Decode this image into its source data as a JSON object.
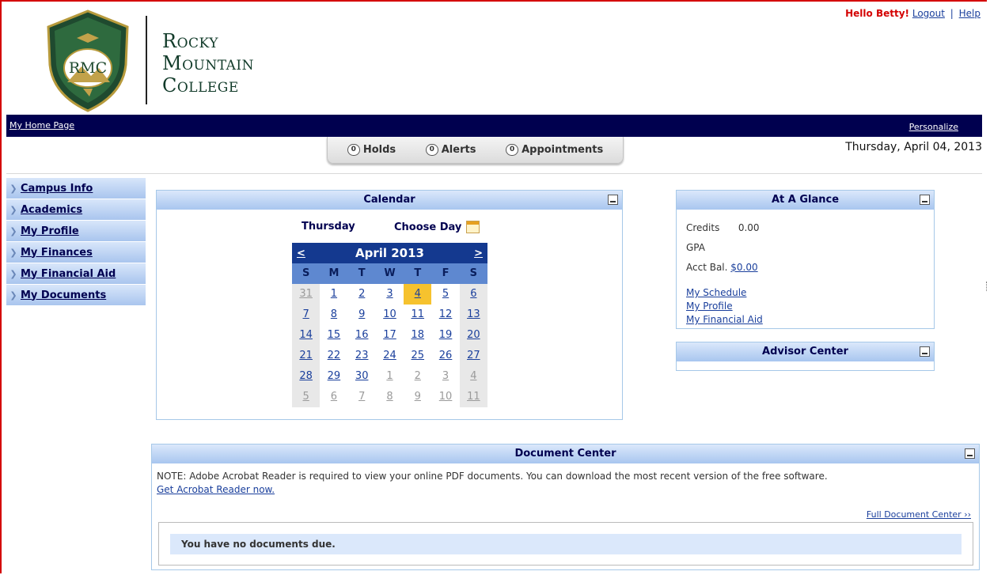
{
  "header": {
    "logo_text": "RMC",
    "college_lines": [
      "Rocky",
      "Mountain",
      "College"
    ],
    "greeting": "Hello Betty!",
    "logout": "Logout",
    "separator": "|",
    "help": "Help"
  },
  "nav": {
    "home": "My Home Page",
    "personalize": "Personalize"
  },
  "tabs": [
    {
      "count": "0",
      "label": "Holds"
    },
    {
      "count": "0",
      "label": "Alerts"
    },
    {
      "count": "0",
      "label": "Appointments"
    }
  ],
  "date": "Thursday, April 04, 2013",
  "sidebar": {
    "items": [
      {
        "label": "Campus Info"
      },
      {
        "label": "Academics"
      },
      {
        "label": "My Profile"
      },
      {
        "label": "My Finances"
      },
      {
        "label": "My Financial Aid"
      },
      {
        "label": "My Documents"
      }
    ]
  },
  "calendar": {
    "title": "Calendar",
    "day_name": "Thursday",
    "choose_day": "Choose Day",
    "month": "April 2013",
    "prev": "<",
    "next": ">",
    "dow": [
      "S",
      "M",
      "T",
      "W",
      "T",
      "F",
      "S"
    ],
    "weeks": [
      [
        {
          "d": "31",
          "o": true
        },
        {
          "d": "1"
        },
        {
          "d": "2"
        },
        {
          "d": "3"
        },
        {
          "d": "4",
          "today": true
        },
        {
          "d": "5"
        },
        {
          "d": "6"
        }
      ],
      [
        {
          "d": "7"
        },
        {
          "d": "8"
        },
        {
          "d": "9"
        },
        {
          "d": "10"
        },
        {
          "d": "11"
        },
        {
          "d": "12"
        },
        {
          "d": "13"
        }
      ],
      [
        {
          "d": "14"
        },
        {
          "d": "15"
        },
        {
          "d": "16"
        },
        {
          "d": "17"
        },
        {
          "d": "18"
        },
        {
          "d": "19"
        },
        {
          "d": "20"
        }
      ],
      [
        {
          "d": "21"
        },
        {
          "d": "22"
        },
        {
          "d": "23"
        },
        {
          "d": "24"
        },
        {
          "d": "25"
        },
        {
          "d": "26"
        },
        {
          "d": "27"
        }
      ],
      [
        {
          "d": "28"
        },
        {
          "d": "29"
        },
        {
          "d": "30"
        },
        {
          "d": "1",
          "o": true
        },
        {
          "d": "2",
          "o": true
        },
        {
          "d": "3",
          "o": true
        },
        {
          "d": "4",
          "o": true
        }
      ],
      [
        {
          "d": "5",
          "o": true
        },
        {
          "d": "6",
          "o": true
        },
        {
          "d": "7",
          "o": true
        },
        {
          "d": "8",
          "o": true
        },
        {
          "d": "9",
          "o": true
        },
        {
          "d": "10",
          "o": true
        },
        {
          "d": "11",
          "o": true
        }
      ]
    ]
  },
  "glance": {
    "title": "At A Glance",
    "credits_label": "Credits",
    "credits_value": "0.00",
    "gpa_label": "GPA",
    "acct_label": "Acct Bal.",
    "acct_value": "$0.00",
    "links": [
      "My Schedule",
      "My Profile",
      "My Financial Aid"
    ]
  },
  "advisor": {
    "title": "Advisor Center"
  },
  "documents": {
    "title": "Document Center",
    "note": "NOTE: Adobe Acrobat Reader is required to view your online PDF documents. You can download the most recent version of the free software.",
    "acrobat_link": "Get Acrobat Reader now.",
    "full_link": "Full Document Center ››",
    "none_due": "You have no documents due."
  }
}
